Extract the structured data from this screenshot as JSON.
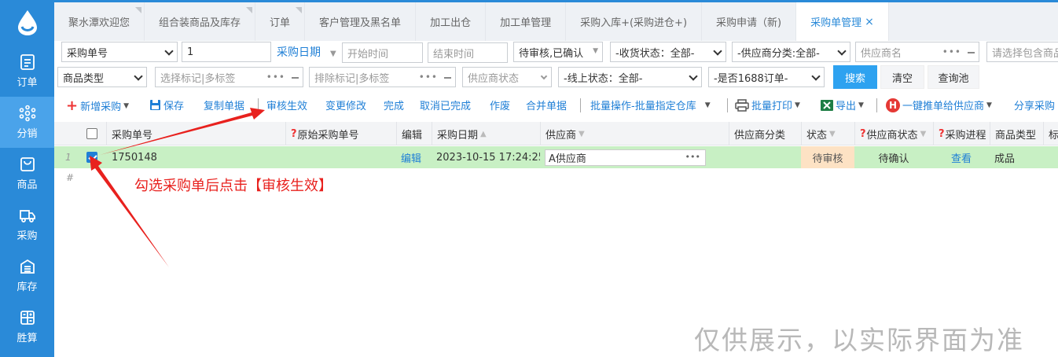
{
  "sidebar": {
    "items": [
      {
        "label": "订单",
        "icon": "order-icon"
      },
      {
        "label": "分销",
        "icon": "distribution-icon",
        "active": true
      },
      {
        "label": "商品",
        "icon": "product-bag-icon"
      },
      {
        "label": "采购",
        "icon": "truck-icon"
      },
      {
        "label": "库存",
        "icon": "warehouse-icon"
      },
      {
        "label": "胜算",
        "icon": "calculator-icon"
      }
    ]
  },
  "tabs": [
    "聚水潭欢迎您",
    "组合装商品及库存",
    "订单",
    "客户管理及黑名单",
    "加工出仓",
    "加工单管理",
    "采购入库+(采购进仓+)",
    "采购申请（新)",
    "采购单管理"
  ],
  "active_tab_close": "×",
  "filters": {
    "order_type": "采购单号",
    "order_value": "1",
    "date_label": "采购日期",
    "start_time": "开始时间",
    "end_time": "结束时间",
    "status": "待审核,已确认",
    "receive_status": "-收货状态：全部-",
    "supplier_category": "-供应商分类:全部-",
    "supplier_name": "供应商名",
    "contains_product": "请选择包含商品",
    "product_type": "商品类型",
    "select_tags": "选择标记|多标签",
    "exclude_tags": "排除标记|多标签",
    "supplier_status": "供应商状态",
    "online_status": "-线上状态：全部-",
    "is_1688": "-是否1688订单-",
    "search_btn": "搜索",
    "clear_btn": "清空",
    "query_pool_btn": "查询池"
  },
  "toolbar": {
    "new": "新增采购",
    "save": "保存",
    "copy": "复制单据",
    "approve": "审核生效",
    "modify": "变更修改",
    "complete": "完成",
    "cancel_complete": "取消已完成",
    "void": "作废",
    "merge": "合并单据",
    "batch": "批量操作-批量指定仓库",
    "print": "批量打印",
    "export": "导出",
    "push": "一键推单给供应商",
    "share": "分享采购"
  },
  "columns": [
    "采购单号",
    "原始采购单号",
    "编辑",
    "采购日期",
    "供应商",
    "供应商分类",
    "状态",
    "供应商状态",
    "采购进程",
    "商品类型",
    "标"
  ],
  "rows": [
    {
      "index": "1",
      "checked": true,
      "order_no": "1750148",
      "original_no": "",
      "edit": "编辑",
      "date": "2023-10-15 17:24:25",
      "supplier": "A供应商",
      "supplier_category": "",
      "status": "待审核",
      "supplier_status": "待确认",
      "progress": "查看",
      "product_type": "成品"
    }
  ],
  "footer_row_marker": "#",
  "annotation": "勾选采购单后点击【审核生效】",
  "watermark": "仅供展示，以实际界面为准",
  "colors": {
    "brand": "#2a8ad8",
    "row_selected": "#c8f0c4",
    "pending": "#fde2c4",
    "annotation": "#e8211e",
    "link": "#1f7fd6"
  }
}
